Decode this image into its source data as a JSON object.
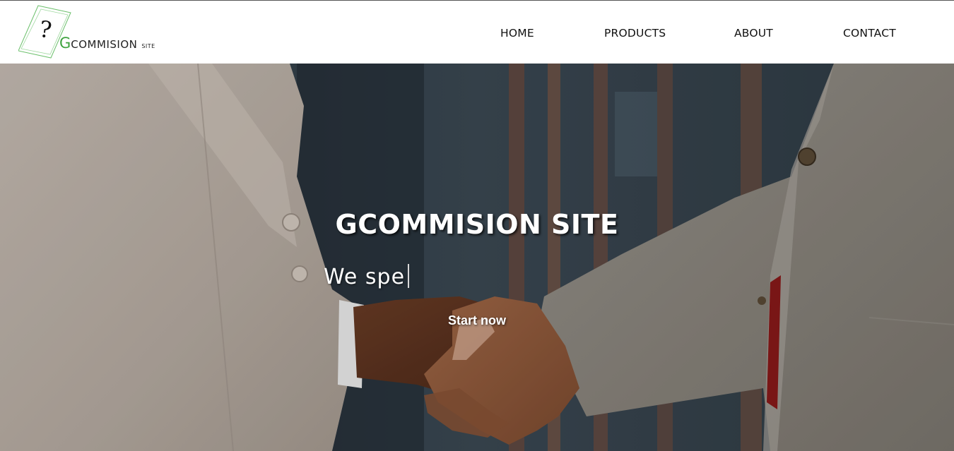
{
  "header": {
    "logo": {
      "mark": "?",
      "big_letter": "G",
      "word": "COMMISION",
      "small": "SITE"
    },
    "nav": {
      "home": "HOME",
      "products": "PRODUCTS",
      "about": "ABOUT",
      "contact": "CONTACT"
    }
  },
  "hero": {
    "title": "GCOMMISION SITE",
    "typing_text": "We spe",
    "cta_label": "Start now",
    "background_description_icon": "handshake-photo"
  },
  "colors": {
    "logo_green": "#3fa33f",
    "header_bg": "#ffffff",
    "hero_text": "#ffffff"
  }
}
